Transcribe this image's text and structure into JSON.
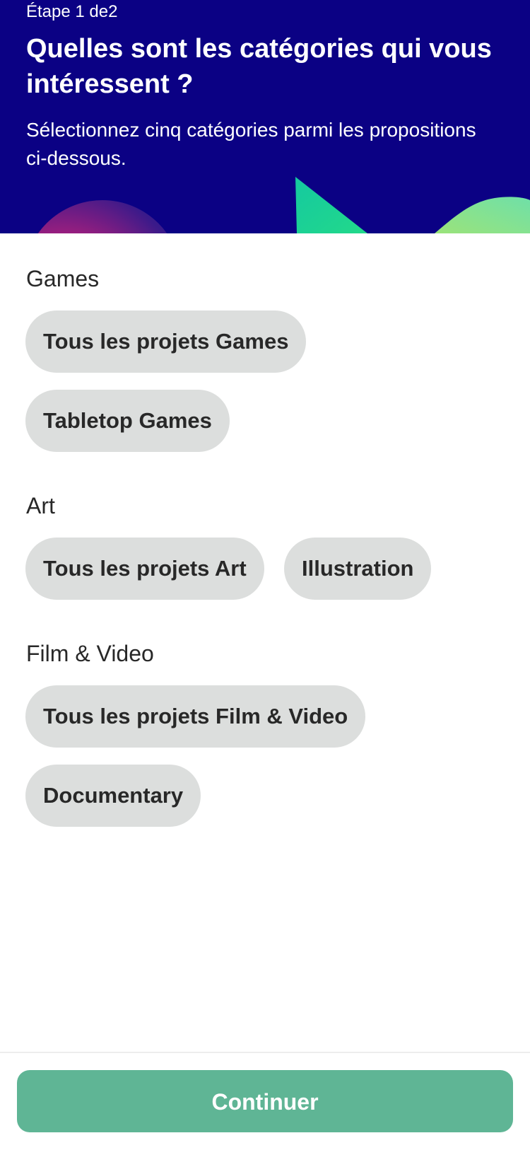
{
  "header": {
    "step_label": "Étape 1 de2",
    "title": "Quelles sont les catégories qui vous intéressent ?",
    "subtitle": "Sélectionnez cinq catégories parmi les propositions ci-dessous."
  },
  "sections": [
    {
      "title": "Games",
      "chips": [
        "Tous les projets Games",
        "Tabletop Games"
      ]
    },
    {
      "title": "Art",
      "chips": [
        "Tous les projets Art",
        "Illustration"
      ]
    },
    {
      "title": "Film & Video",
      "chips": [
        "Tous les projets Film & Video",
        "Documentary"
      ]
    }
  ],
  "footer": {
    "continue_label": "Continuer"
  },
  "colors": {
    "header_bg": "#0b0184",
    "chip_bg": "#dcdedd",
    "continue_bg": "#5fb595"
  }
}
